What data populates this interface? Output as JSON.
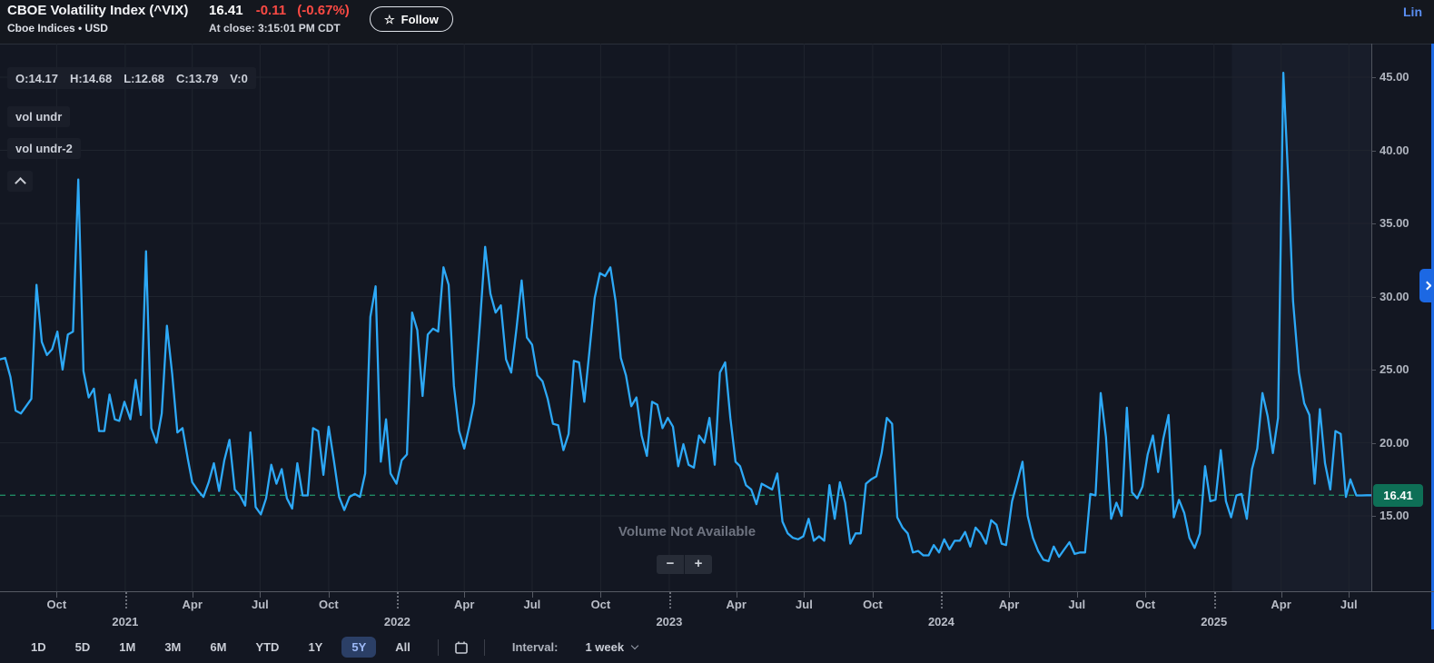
{
  "header": {
    "title": "CBOE Volatility Index (^VIX)",
    "subtitle": "Cboe Indices • USD",
    "price": "16.41",
    "change": "-0.11",
    "change_pct": "(-0.67%)",
    "at_close": "At close: 3:15:01 PM CDT",
    "star_glyph": "☆",
    "follow_label": "Follow",
    "chart_type_label": "Lin"
  },
  "overlays": {
    "ohlc_items": [
      "O:14.17",
      "H:14.68",
      "L:12.68",
      "C:13.79",
      "V:0"
    ],
    "indicator_chips": [
      "vol undr",
      "vol undr-2"
    ],
    "volume_message": "Volume Not Available",
    "zoom_out_label": "−",
    "zoom_in_label": "+"
  },
  "toolbar": {
    "ranges": [
      "1D",
      "5D",
      "1M",
      "3M",
      "6M",
      "YTD",
      "1Y",
      "5Y",
      "All"
    ],
    "selected_range": "5Y",
    "interval_label": "Interval:",
    "interval_value": "1 week"
  },
  "chart_data": {
    "type": "line",
    "series_name": "^VIX weekly close",
    "x_start": "2020-07-17",
    "x_end": "2025-07-25",
    "ylim": [
      9.9,
      47.3
    ],
    "grid": true,
    "line_color": "#2da9f7",
    "current_price": "16.41",
    "current_price_value": 16.41,
    "current_line_color": "#1f8a63",
    "badge_color": "#0e6f56",
    "highlight_from": "2025-01-25",
    "y_ticks": [
      {
        "label": "45.00",
        "value": 45
      },
      {
        "label": "40.00",
        "value": 40
      },
      {
        "label": "35.00",
        "value": 35
      },
      {
        "label": "30.00",
        "value": 30
      },
      {
        "label": "25.00",
        "value": 25
      },
      {
        "label": "20.00",
        "value": 20
      },
      {
        "label": "15.00",
        "value": 15
      }
    ],
    "x_ticks": [
      {
        "label": "Oct",
        "kind": "month",
        "date": "2020-10-01"
      },
      {
        "label": "2021",
        "kind": "year",
        "date": "2021-01-01"
      },
      {
        "label": "Apr",
        "kind": "month",
        "date": "2021-04-01"
      },
      {
        "label": "Jul",
        "kind": "month",
        "date": "2021-07-01"
      },
      {
        "label": "Oct",
        "kind": "month",
        "date": "2021-10-01"
      },
      {
        "label": "2022",
        "kind": "year",
        "date": "2022-01-01"
      },
      {
        "label": "Apr",
        "kind": "month",
        "date": "2022-04-01"
      },
      {
        "label": "Jul",
        "kind": "month",
        "date": "2022-07-01"
      },
      {
        "label": "Oct",
        "kind": "month",
        "date": "2022-10-01"
      },
      {
        "label": "2023",
        "kind": "year",
        "date": "2023-01-01"
      },
      {
        "label": "Apr",
        "kind": "month",
        "date": "2023-04-01"
      },
      {
        "label": "Jul",
        "kind": "month",
        "date": "2023-07-01"
      },
      {
        "label": "Oct",
        "kind": "month",
        "date": "2023-10-01"
      },
      {
        "label": "2024",
        "kind": "year",
        "date": "2024-01-01"
      },
      {
        "label": "Apr",
        "kind": "month",
        "date": "2024-04-01"
      },
      {
        "label": "Jul",
        "kind": "month",
        "date": "2024-07-01"
      },
      {
        "label": "Oct",
        "kind": "month",
        "date": "2024-10-01"
      },
      {
        "label": "2025",
        "kind": "year",
        "date": "2025-01-01"
      },
      {
        "label": "Apr",
        "kind": "month",
        "date": "2025-04-01"
      },
      {
        "label": "Jul",
        "kind": "month",
        "date": "2025-07-01"
      }
    ],
    "points": [
      [
        "2020-07-17",
        25.7
      ],
      [
        "2020-07-24",
        25.8
      ],
      [
        "2020-07-31",
        24.5
      ],
      [
        "2020-08-07",
        22.2
      ],
      [
        "2020-08-14",
        22.0
      ],
      [
        "2020-08-21",
        22.5
      ],
      [
        "2020-08-28",
        23.0
      ],
      [
        "2020-09-04",
        30.8
      ],
      [
        "2020-09-11",
        26.9
      ],
      [
        "2020-09-18",
        26.0
      ],
      [
        "2020-09-25",
        26.4
      ],
      [
        "2020-10-02",
        27.6
      ],
      [
        "2020-10-09",
        25.0
      ],
      [
        "2020-10-16",
        27.4
      ],
      [
        "2020-10-23",
        27.6
      ],
      [
        "2020-10-30",
        38.0
      ],
      [
        "2020-11-06",
        24.9
      ],
      [
        "2020-11-13",
        23.1
      ],
      [
        "2020-11-20",
        23.7
      ],
      [
        "2020-11-27",
        20.8
      ],
      [
        "2020-12-04",
        20.8
      ],
      [
        "2020-12-11",
        23.3
      ],
      [
        "2020-12-18",
        21.6
      ],
      [
        "2020-12-24",
        21.5
      ],
      [
        "2020-12-31",
        22.8
      ],
      [
        "2021-01-08",
        21.6
      ],
      [
        "2021-01-15",
        24.3
      ],
      [
        "2021-01-22",
        21.9
      ],
      [
        "2021-01-29",
        33.1
      ],
      [
        "2021-02-05",
        21.0
      ],
      [
        "2021-02-12",
        20.0
      ],
      [
        "2021-02-19",
        22.0
      ],
      [
        "2021-02-26",
        28.0
      ],
      [
        "2021-03-05",
        24.7
      ],
      [
        "2021-03-12",
        20.7
      ],
      [
        "2021-03-19",
        21.0
      ],
      [
        "2021-03-26",
        18.9
      ],
      [
        "2021-04-01",
        17.3
      ],
      [
        "2021-04-09",
        16.7
      ],
      [
        "2021-04-16",
        16.3
      ],
      [
        "2021-04-23",
        17.3
      ],
      [
        "2021-04-30",
        18.6
      ],
      [
        "2021-05-07",
        16.7
      ],
      [
        "2021-05-14",
        18.8
      ],
      [
        "2021-05-21",
        20.2
      ],
      [
        "2021-05-28",
        16.8
      ],
      [
        "2021-06-04",
        16.4
      ],
      [
        "2021-06-11",
        15.7
      ],
      [
        "2021-06-18",
        20.7
      ],
      [
        "2021-06-25",
        15.6
      ],
      [
        "2021-07-02",
        15.1
      ],
      [
        "2021-07-09",
        16.2
      ],
      [
        "2021-07-16",
        18.5
      ],
      [
        "2021-07-23",
        17.2
      ],
      [
        "2021-07-30",
        18.2
      ],
      [
        "2021-08-06",
        16.2
      ],
      [
        "2021-08-13",
        15.5
      ],
      [
        "2021-08-20",
        18.6
      ],
      [
        "2021-08-27",
        16.4
      ],
      [
        "2021-09-03",
        16.4
      ],
      [
        "2021-09-10",
        21.0
      ],
      [
        "2021-09-17",
        20.8
      ],
      [
        "2021-09-24",
        17.8
      ],
      [
        "2021-10-01",
        21.1
      ],
      [
        "2021-10-08",
        18.8
      ],
      [
        "2021-10-15",
        16.3
      ],
      [
        "2021-10-22",
        15.4
      ],
      [
        "2021-10-29",
        16.3
      ],
      [
        "2021-11-05",
        16.5
      ],
      [
        "2021-11-12",
        16.3
      ],
      [
        "2021-11-19",
        17.9
      ],
      [
        "2021-11-26",
        28.6
      ],
      [
        "2021-12-03",
        30.7
      ],
      [
        "2021-12-10",
        18.7
      ],
      [
        "2021-12-17",
        21.6
      ],
      [
        "2021-12-23",
        17.9
      ],
      [
        "2021-12-31",
        17.2
      ],
      [
        "2022-01-07",
        18.8
      ],
      [
        "2022-01-14",
        19.2
      ],
      [
        "2022-01-21",
        28.9
      ],
      [
        "2022-01-28",
        27.7
      ],
      [
        "2022-02-04",
        23.2
      ],
      [
        "2022-02-11",
        27.4
      ],
      [
        "2022-02-18",
        27.8
      ],
      [
        "2022-02-25",
        27.6
      ],
      [
        "2022-03-04",
        32.0
      ],
      [
        "2022-03-11",
        30.8
      ],
      [
        "2022-03-18",
        23.9
      ],
      [
        "2022-03-25",
        20.8
      ],
      [
        "2022-04-01",
        19.6
      ],
      [
        "2022-04-08",
        21.2
      ],
      [
        "2022-04-14",
        22.7
      ],
      [
        "2022-04-22",
        28.2
      ],
      [
        "2022-04-29",
        33.4
      ],
      [
        "2022-05-06",
        30.2
      ],
      [
        "2022-05-13",
        28.9
      ],
      [
        "2022-05-20",
        29.4
      ],
      [
        "2022-05-27",
        25.7
      ],
      [
        "2022-06-03",
        24.8
      ],
      [
        "2022-06-10",
        27.8
      ],
      [
        "2022-06-17",
        31.1
      ],
      [
        "2022-06-24",
        27.2
      ],
      [
        "2022-07-01",
        26.7
      ],
      [
        "2022-07-08",
        24.6
      ],
      [
        "2022-07-15",
        24.2
      ],
      [
        "2022-07-22",
        23.0
      ],
      [
        "2022-07-29",
        21.3
      ],
      [
        "2022-08-05",
        21.2
      ],
      [
        "2022-08-12",
        19.5
      ],
      [
        "2022-08-19",
        20.6
      ],
      [
        "2022-08-26",
        25.6
      ],
      [
        "2022-09-02",
        25.5
      ],
      [
        "2022-09-09",
        22.8
      ],
      [
        "2022-09-16",
        26.3
      ],
      [
        "2022-09-23",
        29.9
      ],
      [
        "2022-09-30",
        31.6
      ],
      [
        "2022-10-07",
        31.4
      ],
      [
        "2022-10-14",
        32.0
      ],
      [
        "2022-10-21",
        29.7
      ],
      [
        "2022-10-28",
        25.8
      ],
      [
        "2022-11-04",
        24.6
      ],
      [
        "2022-11-11",
        22.5
      ],
      [
        "2022-11-18",
        23.1
      ],
      [
        "2022-11-25",
        20.5
      ],
      [
        "2022-12-02",
        19.1
      ],
      [
        "2022-12-09",
        22.8
      ],
      [
        "2022-12-16",
        22.6
      ],
      [
        "2022-12-23",
        21.0
      ],
      [
        "2022-12-30",
        21.7
      ],
      [
        "2023-01-06",
        21.1
      ],
      [
        "2023-01-13",
        18.4
      ],
      [
        "2023-01-20",
        19.9
      ],
      [
        "2023-01-27",
        18.5
      ],
      [
        "2023-02-03",
        18.3
      ],
      [
        "2023-02-10",
        20.5
      ],
      [
        "2023-02-17",
        20.0
      ],
      [
        "2023-02-24",
        21.7
      ],
      [
        "2023-03-03",
        18.5
      ],
      [
        "2023-03-10",
        24.8
      ],
      [
        "2023-03-17",
        25.5
      ],
      [
        "2023-03-24",
        21.7
      ],
      [
        "2023-03-31",
        18.7
      ],
      [
        "2023-04-06",
        18.4
      ],
      [
        "2023-04-14",
        17.1
      ],
      [
        "2023-04-21",
        16.8
      ],
      [
        "2023-04-28",
        15.8
      ],
      [
        "2023-05-05",
        17.2
      ],
      [
        "2023-05-12",
        17.0
      ],
      [
        "2023-05-19",
        16.8
      ],
      [
        "2023-05-26",
        17.9
      ],
      [
        "2023-06-02",
        14.6
      ],
      [
        "2023-06-09",
        13.8
      ],
      [
        "2023-06-16",
        13.5
      ],
      [
        "2023-06-23",
        13.4
      ],
      [
        "2023-06-30",
        13.6
      ],
      [
        "2023-07-07",
        14.8
      ],
      [
        "2023-07-14",
        13.3
      ],
      [
        "2023-07-21",
        13.6
      ],
      [
        "2023-07-28",
        13.3
      ],
      [
        "2023-08-04",
        17.1
      ],
      [
        "2023-08-11",
        14.8
      ],
      [
        "2023-08-18",
        17.3
      ],
      [
        "2023-08-25",
        15.9
      ],
      [
        "2023-09-01",
        13.1
      ],
      [
        "2023-09-08",
        13.8
      ],
      [
        "2023-09-15",
        13.8
      ],
      [
        "2023-09-22",
        17.2
      ],
      [
        "2023-09-29",
        17.5
      ],
      [
        "2023-10-06",
        17.7
      ],
      [
        "2023-10-13",
        19.3
      ],
      [
        "2023-10-20",
        21.7
      ],
      [
        "2023-10-27",
        21.3
      ],
      [
        "2023-11-03",
        14.9
      ],
      [
        "2023-11-10",
        14.2
      ],
      [
        "2023-11-17",
        13.8
      ],
      [
        "2023-11-24",
        12.5
      ],
      [
        "2023-12-01",
        12.6
      ],
      [
        "2023-12-08",
        12.3
      ],
      [
        "2023-12-15",
        12.3
      ],
      [
        "2023-12-22",
        13.0
      ],
      [
        "2023-12-29",
        12.5
      ],
      [
        "2024-01-05",
        13.4
      ],
      [
        "2024-01-12",
        12.7
      ],
      [
        "2024-01-19",
        13.3
      ],
      [
        "2024-01-26",
        13.3
      ],
      [
        "2024-02-02",
        13.9
      ],
      [
        "2024-02-09",
        12.9
      ],
      [
        "2024-02-16",
        14.2
      ],
      [
        "2024-02-23",
        13.8
      ],
      [
        "2024-03-01",
        13.1
      ],
      [
        "2024-03-08",
        14.7
      ],
      [
        "2024-03-15",
        14.4
      ],
      [
        "2024-03-22",
        13.1
      ],
      [
        "2024-03-28",
        13.0
      ],
      [
        "2024-04-05",
        16.0
      ],
      [
        "2024-04-12",
        17.3
      ],
      [
        "2024-04-19",
        18.7
      ],
      [
        "2024-04-26",
        15.0
      ],
      [
        "2024-05-03",
        13.5
      ],
      [
        "2024-05-10",
        12.6
      ],
      [
        "2024-05-17",
        12.0
      ],
      [
        "2024-05-24",
        11.9
      ],
      [
        "2024-05-31",
        12.9
      ],
      [
        "2024-06-07",
        12.2
      ],
      [
        "2024-06-14",
        12.7
      ],
      [
        "2024-06-21",
        13.2
      ],
      [
        "2024-06-28",
        12.4
      ],
      [
        "2024-07-05",
        12.5
      ],
      [
        "2024-07-12",
        12.5
      ],
      [
        "2024-07-19",
        16.5
      ],
      [
        "2024-07-26",
        16.4
      ],
      [
        "2024-08-02",
        23.4
      ],
      [
        "2024-08-09",
        20.4
      ],
      [
        "2024-08-16",
        14.8
      ],
      [
        "2024-08-23",
        15.9
      ],
      [
        "2024-08-30",
        15.0
      ],
      [
        "2024-09-06",
        22.4
      ],
      [
        "2024-09-13",
        16.6
      ],
      [
        "2024-09-20",
        16.2
      ],
      [
        "2024-09-27",
        17.0
      ],
      [
        "2024-10-04",
        19.2
      ],
      [
        "2024-10-11",
        20.5
      ],
      [
        "2024-10-18",
        18.0
      ],
      [
        "2024-10-25",
        20.3
      ],
      [
        "2024-11-01",
        21.9
      ],
      [
        "2024-11-08",
        14.9
      ],
      [
        "2024-11-15",
        16.1
      ],
      [
        "2024-11-22",
        15.2
      ],
      [
        "2024-11-29",
        13.5
      ],
      [
        "2024-12-06",
        12.8
      ],
      [
        "2024-12-13",
        13.8
      ],
      [
        "2024-12-20",
        18.4
      ],
      [
        "2024-12-27",
        16.0
      ],
      [
        "2025-01-03",
        16.1
      ],
      [
        "2025-01-10",
        19.5
      ],
      [
        "2025-01-17",
        16.0
      ],
      [
        "2025-01-24",
        14.9
      ],
      [
        "2025-01-31",
        16.4
      ],
      [
        "2025-02-07",
        16.5
      ],
      [
        "2025-02-14",
        14.8
      ],
      [
        "2025-02-21",
        18.2
      ],
      [
        "2025-02-28",
        19.6
      ],
      [
        "2025-03-07",
        23.4
      ],
      [
        "2025-03-14",
        21.8
      ],
      [
        "2025-03-21",
        19.3
      ],
      [
        "2025-03-28",
        21.7
      ],
      [
        "2025-04-04",
        45.3
      ],
      [
        "2025-04-11",
        37.6
      ],
      [
        "2025-04-17",
        29.7
      ],
      [
        "2025-04-25",
        24.8
      ],
      [
        "2025-05-02",
        22.7
      ],
      [
        "2025-05-09",
        21.9
      ],
      [
        "2025-05-16",
        17.2
      ],
      [
        "2025-05-23",
        22.3
      ],
      [
        "2025-05-30",
        18.6
      ],
      [
        "2025-06-06",
        16.8
      ],
      [
        "2025-06-13",
        20.8
      ],
      [
        "2025-06-20",
        20.6
      ],
      [
        "2025-06-27",
        16.3
      ],
      [
        "2025-07-03",
        17.5
      ],
      [
        "2025-07-11",
        16.4
      ],
      [
        "2025-07-18",
        16.4
      ],
      [
        "2025-07-25",
        16.41
      ]
    ]
  }
}
